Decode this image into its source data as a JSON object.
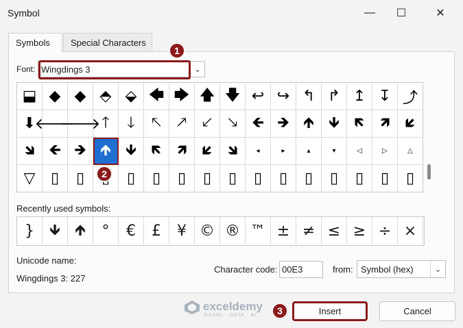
{
  "window": {
    "title": "Symbol",
    "minimize_glyph": "—",
    "maximize_glyph": "☐",
    "close_glyph": "✕"
  },
  "tabs": [
    {
      "label": "Symbols",
      "active": true
    },
    {
      "label": "Special Characters",
      "active": false
    }
  ],
  "font": {
    "label": "Font:",
    "value": "Wingdings 3",
    "arrow": "⌄"
  },
  "symbol_grid": {
    "rows": [
      [
        "⬓",
        "◆",
        "◆",
        "⬘",
        "⬙",
        "🡄",
        "🡆",
        "🡅",
        "🡇",
        "↩",
        "↪",
        "↰",
        "↱",
        "↥",
        "↧",
        "⤴"
      ],
      [
        "⬇",
        "🡐",
        "🡒",
        "🡑",
        "🡓",
        "🡔",
        "🡕",
        "🡗",
        "🡖",
        "🡸",
        "🡺",
        "🡹",
        "🡻",
        "🡼",
        "🡽",
        "🡿"
      ],
      [
        "🡾",
        "🡸",
        "🡺",
        "🡹",
        "🡻",
        "🡼",
        "🡽",
        "🡿",
        "🡾",
        "◂",
        "▸",
        "▴",
        "▾",
        "◁",
        "▷",
        "△"
      ],
      [
        "▽",
        "▯",
        "▯",
        "▯",
        "▯",
        "▯",
        "▯",
        "▯",
        "▯",
        "▯",
        "▯",
        "▯",
        "▯",
        "▯",
        "▯",
        "▯"
      ]
    ],
    "selected_row": 2,
    "selected_col": 3
  },
  "recent": {
    "label": "Recently used symbols:",
    "symbols": [
      "}",
      "🡻",
      "🡹",
      "°",
      "€",
      "£",
      "¥",
      "©",
      "®",
      "™",
      "±",
      "≠",
      "≤",
      "≥",
      "÷",
      "×"
    ]
  },
  "unicode": {
    "label": "Unicode name:",
    "value": "Wingdings 3: 227"
  },
  "char_code": {
    "label": "Character code:",
    "value": "00E3"
  },
  "from": {
    "label": "from:",
    "value": "Symbol (hex)",
    "arrow": "⌄"
  },
  "buttons": {
    "insert": "Insert",
    "cancel": "Cancel"
  },
  "badges": [
    "1",
    "2",
    "3"
  ],
  "watermark": {
    "name": "exceldemy",
    "tagline": "EXCEL · DATA · BI"
  },
  "colors": {
    "highlight": "#8b1a1a",
    "selection": "#1f6ed2"
  }
}
